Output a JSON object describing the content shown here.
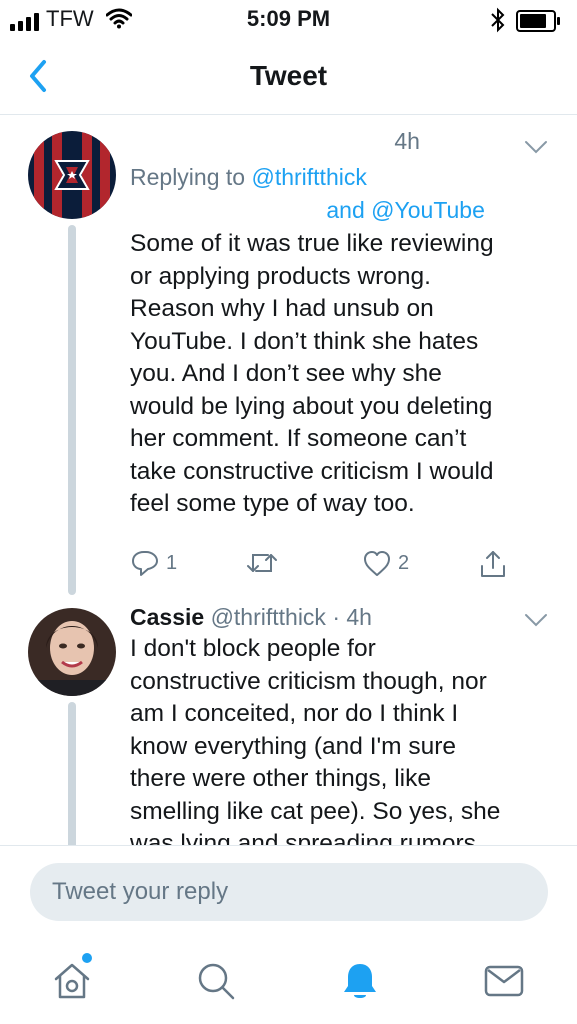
{
  "status_bar": {
    "carrier": "TFW",
    "time": "5:09 PM"
  },
  "navbar": {
    "title": "Tweet",
    "back_icon": "chevron-left-icon"
  },
  "tweets": [
    {
      "name": "",
      "handle": "",
      "time": "4h",
      "replying_prefix": "Replying to",
      "replying_to": "@thriftthick",
      "replying_and": "and",
      "replying_also": "@YouTube",
      "text_lines": [
        "Some of it was true like reviewing",
        "or applying products wrong.",
        "Reason why I had unsub on",
        "YouTube. I don’t think she hates",
        "you. And I don’t see why she",
        "would be lying about you deleting",
        "her comment. If someone can’t",
        "take constructive criticism I would",
        "feel some type of way too."
      ],
      "reply_count": "1",
      "retweet_count": "",
      "like_count": "2"
    },
    {
      "name": "Cassie",
      "handle": "@thriftthick",
      "separator": "·",
      "time": "4h",
      "text_lines": [
        "I don't block people for",
        "constructive criticism though, nor",
        "am I conceited, nor do I think I",
        "know everything (and I'm sure",
        "there were other things, like",
        "smelling like cat pee). So yes, she",
        "was lying and spreading rumors"
      ]
    }
  ],
  "reply_bar": {
    "placeholder": "Tweet your reply"
  },
  "tab_bar": {
    "items": [
      "home-icon",
      "search-icon",
      "notifications-icon",
      "messages-icon"
    ],
    "active": "notifications-icon"
  },
  "colors": {
    "accent": "#1da1f2",
    "secondary_text": "#657786",
    "thread_line": "#ccd6dd",
    "divider": "#e1e8ed"
  }
}
